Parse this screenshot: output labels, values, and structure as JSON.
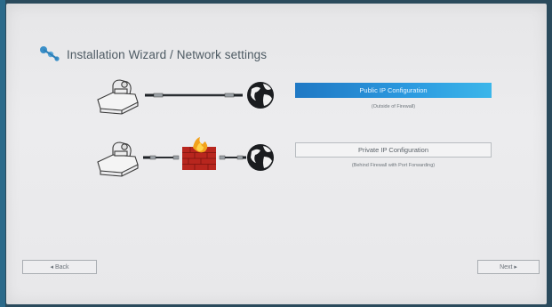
{
  "wizard": {
    "title": "Installation Wizard / Network settings",
    "logo_icon": "wizard-logo-icon"
  },
  "options": {
    "public": {
      "label": "Public IP Configuration",
      "sublabel": "(Outside of Firewall)",
      "selected": true,
      "accent": "#2c9be0"
    },
    "private": {
      "label": "Private IP Configuration",
      "sublabel": "(Behind Firewall with Port Forwarding)",
      "selected": false
    }
  },
  "illustrations": {
    "public": [
      "camera-codec-icon",
      "network-cable-icon",
      "globe-icon"
    ],
    "private": [
      "camera-codec-icon",
      "network-cable-icon",
      "firewall-icon",
      "network-cable-icon",
      "globe-icon"
    ]
  },
  "nav": {
    "back_label": "◂ Back",
    "next_label": "Next ▸"
  }
}
